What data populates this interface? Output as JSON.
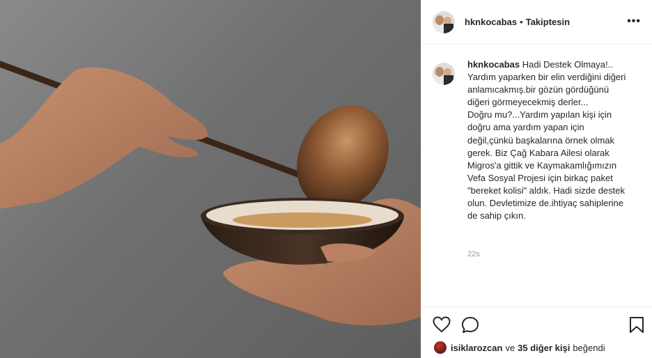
{
  "post": {
    "username": "hknkocabas",
    "separator": "•",
    "follow_status": "Takiptesin",
    "more_label": "•••",
    "caption_text": "Hadi Destek Olmaya!..\nYardım yaparken bir elin verdiğini diğeri anlamıcakmış.bir gözün gördüğünü diğeri görmeyecekmiş derler...\nDoğru mu?...Yardım yapılan kişi için doğru ama yardım yapan için değil,çünkü başkalarına örnek olmak gerek. Biz Çağ Kabara Ailesi olarak Migros'a gittik ve Kaymakamlığımızın Vefa Sosyal Projesi için birkaç paket \"bereket kolisi\" aldık. Hadi sizde destek olun. Devletimize de.ihtiyaç sahiplerine de sahip çıkın.",
    "time_ago": "22s"
  },
  "likes": {
    "user": "isiklarozcan",
    "conjunction": "ve",
    "others": "35 diğer kişi",
    "suffix": "beğendi"
  },
  "icons": {
    "like": "heart-icon",
    "comment": "comment-icon",
    "save": "bookmark-icon",
    "more": "more-options-icon"
  }
}
